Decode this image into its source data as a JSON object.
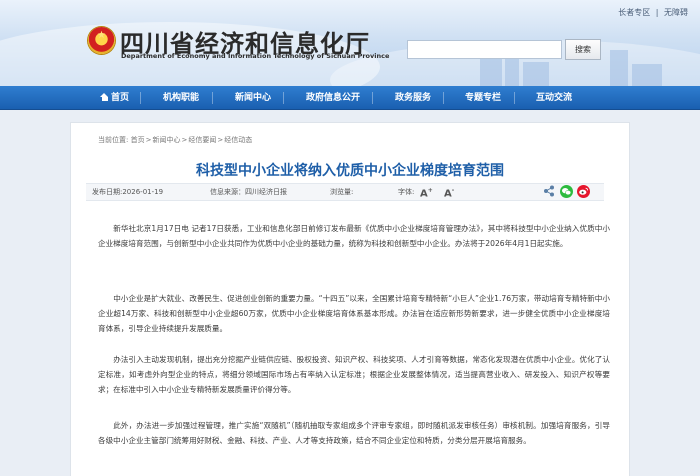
{
  "header": {
    "top_links": [
      "长者专区",
      "|",
      "无障碍"
    ],
    "site_title": "四川省经济和信息化厅",
    "site_subtitle": "Department of Economy and Information Technology of Sichuan Province",
    "search_placeholder": "",
    "search_button": "搜索"
  },
  "nav": {
    "items": [
      "首页",
      "机构职能",
      "新闻中心",
      "政府信息公开",
      "政务服务",
      "专题专栏",
      "互动交流"
    ]
  },
  "breadcrumb": {
    "prefix": "当前位置:",
    "items": [
      "首页",
      "新闻中心",
      "经信要闻",
      "经信动态"
    ],
    "separator": ">"
  },
  "article": {
    "title": "科技型中小企业将纳入优质中小企业梯度培育范围",
    "publish_date": "发布日期:2026-01-19",
    "source": "信息来源：四川经济日报",
    "views_label": "浏览量:",
    "font_label": "字体:",
    "font_larger": "A",
    "font_smaller": "A",
    "paragraphs": [
      "新华社北京1月17日电 记者17日获悉，工业和信息化部日前修订发布最新《优质中小企业梯度培育管理办法》，其中将科技型中小企业纳入优质中小企业梯度培育范围，与创新型中小企业共同作为优质中小企业的基础力量，统称为科技和创新型中小企业。办法将于2026年4月1日起实施。",
      "中小企业是扩大就业、改善民生、促进创业创新的重要力量。“十四五”以来，全国累计培育专精特新“小巨人”企业1.76万家，带动培育专精特新中小企业超14万家、科技和创新型中小企业超60万家，优质中小企业梯度培育体系基本形成。办法旨在适应新形势新要求，进一步健全优质中小企业梯度培育体系，引导企业持续提升发展质量。",
      "办法引入主动发现机制，提出充分挖掘产业链供应链、股权投资、知识产权、科技奖项、人才引育等数据，常态化发现潜在优质中小企业。优化了认定标准，如考虑外向型企业的特点，将细分领域国际市场占有率纳入认定标准；根据企业发展整体情况，适当提高营业收入、研发投入、知识产权等要求；在标准中引入中小企业专精特新发展质量评价得分等。",
      "此外，办法进一步加强过程管理，推广实施“双随机”（随机抽取专家组成多个评审专家组，即时随机派发审核任务）审核机制。加强培育服务，引导各级中小企业主管部门统筹用好财税、金融、科技、产业、人才等支持政策，结合不同企业定位和特质，分类分层开展培育服务。"
    ]
  },
  "share": {
    "icons": [
      "share-icon",
      "wechat-icon",
      "weibo-icon"
    ],
    "colors": {
      "share": "#5b7fa6",
      "wechat": "#2dbb3e",
      "weibo": "#e6162d"
    }
  },
  "colors": {
    "nav": "#1f6ac0",
    "title": "#1f5fa8",
    "background": "#e9eef5"
  }
}
